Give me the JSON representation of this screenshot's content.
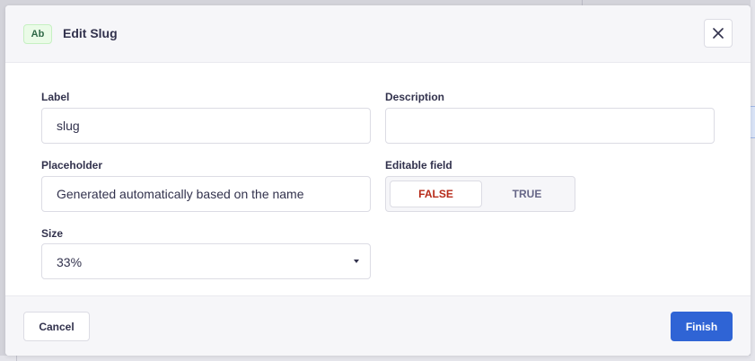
{
  "modal": {
    "type_badge": "Ab",
    "title": "Edit Slug"
  },
  "form": {
    "label": {
      "label": "Label",
      "value": "slug"
    },
    "description": {
      "label": "Description",
      "value": ""
    },
    "placeholder": {
      "label": "Placeholder",
      "value": "Generated automatically based on the name"
    },
    "editable": {
      "label": "Editable field",
      "options": [
        "FALSE",
        "TRUE"
      ],
      "selected": "FALSE"
    },
    "size": {
      "label": "Size",
      "value": "33%"
    }
  },
  "footer": {
    "cancel_label": "Cancel",
    "finish_label": "Finish"
  },
  "colors": {
    "primary": "#2f64d5",
    "danger_text": "#b72b1a",
    "badge_bg": "#eafbe7"
  },
  "icons": {
    "close": "close-icon",
    "caret": "chevron-down-icon"
  }
}
